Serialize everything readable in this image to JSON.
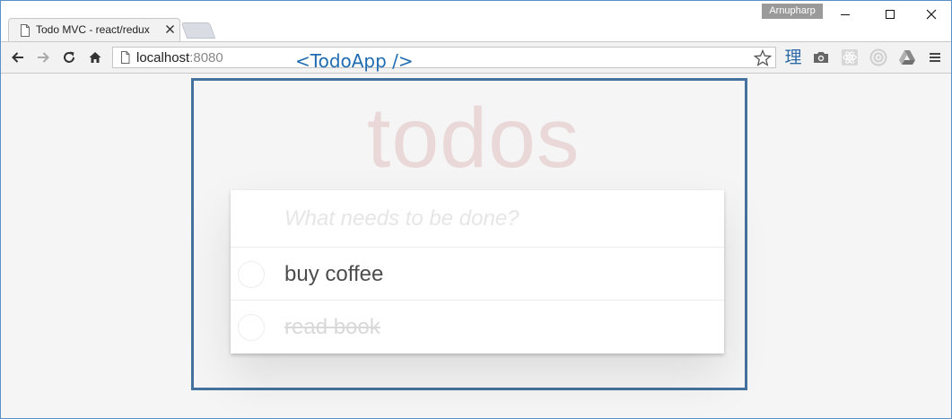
{
  "window": {
    "user_badge": "Arnupharp"
  },
  "tab": {
    "title": "Todo MVC - react/redux"
  },
  "address_bar": {
    "host": "localhost",
    "port": ":8080"
  },
  "extensions": {
    "li_glyph": "理"
  },
  "devtools_overlay": {
    "component_label": "<TodoApp />",
    "highlight_color": "#44719e",
    "label_color": "#1f6cb1"
  },
  "app": {
    "title": "todos",
    "new_todo_placeholder": "What needs to be done?",
    "todos": [
      {
        "text": "buy coffee",
        "completed": false
      },
      {
        "text": "read book",
        "completed": true
      }
    ]
  }
}
